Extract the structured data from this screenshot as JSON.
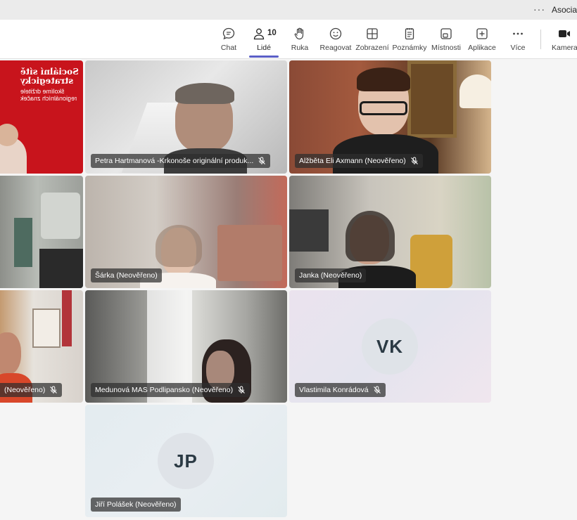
{
  "titlebar": {
    "more": "···",
    "title": "Asociac"
  },
  "toolbar": {
    "chat": "Chat",
    "people": "Lidé",
    "people_count": "10",
    "raise": "Ruka",
    "react": "Reagovat",
    "view": "Zobrazení",
    "notes": "Poznámky",
    "rooms": "Místnosti",
    "apps": "Aplikace",
    "more": "Více",
    "camera": "Kamera"
  },
  "slide": {
    "line1": "Sociální sítě",
    "line2": "strategicky",
    "line3": "školíme držitele",
    "line4": "regionálních značek"
  },
  "participants": [
    {
      "name": "Petra Hartmanová -Krkonoše originální produk...",
      "muted": true
    },
    {
      "name": "Alžběta Eli Axmann (Neověřeno)",
      "muted": true
    },
    {
      "name": "Šárka (Neověřeno)",
      "muted": false
    },
    {
      "name": "Janka (Neověřeno)",
      "muted": false
    },
    {
      "name": "(Neověřeno)",
      "muted": true
    },
    {
      "name": "Medunová MAS Podlipansko (Neověřeno)",
      "muted": true
    },
    {
      "name": "Vlastimila Konrádová",
      "muted": true,
      "initials": "VK"
    },
    {
      "name": "Jiří Polášek (Neověřeno)",
      "muted": false,
      "initials": "JP"
    }
  ]
}
